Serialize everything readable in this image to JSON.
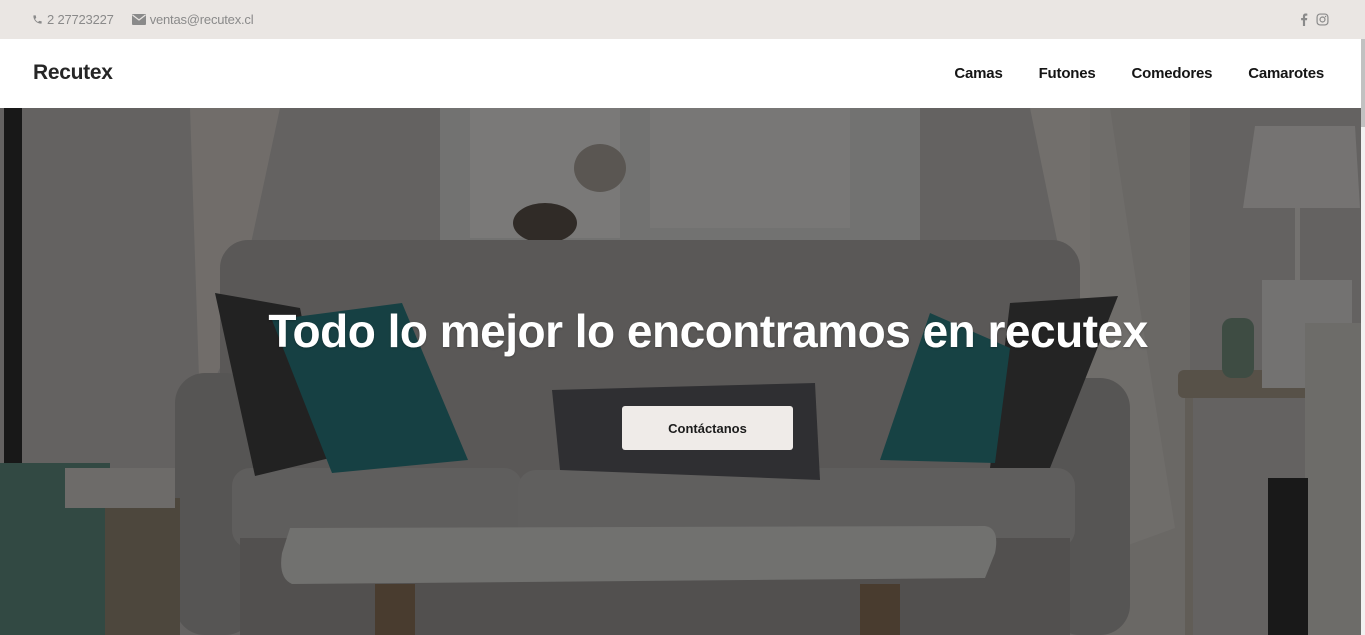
{
  "topbar": {
    "phone": "2 27723227",
    "email": "ventas@recutex.cl",
    "social": [
      "facebook-icon",
      "instagram-icon"
    ]
  },
  "navbar": {
    "brand": "Recutex",
    "links": [
      {
        "label": "Camas"
      },
      {
        "label": "Futones"
      },
      {
        "label": "Comedores"
      },
      {
        "label": "Camarotes"
      }
    ]
  },
  "hero": {
    "title": "Todo lo mejor lo encontramos en recutex",
    "cta_label": "Contáctanos"
  },
  "colors": {
    "topbar_bg": "#eae6e3",
    "cta_bg": "#efebe8",
    "teal_pillow": "#1f6e72"
  }
}
